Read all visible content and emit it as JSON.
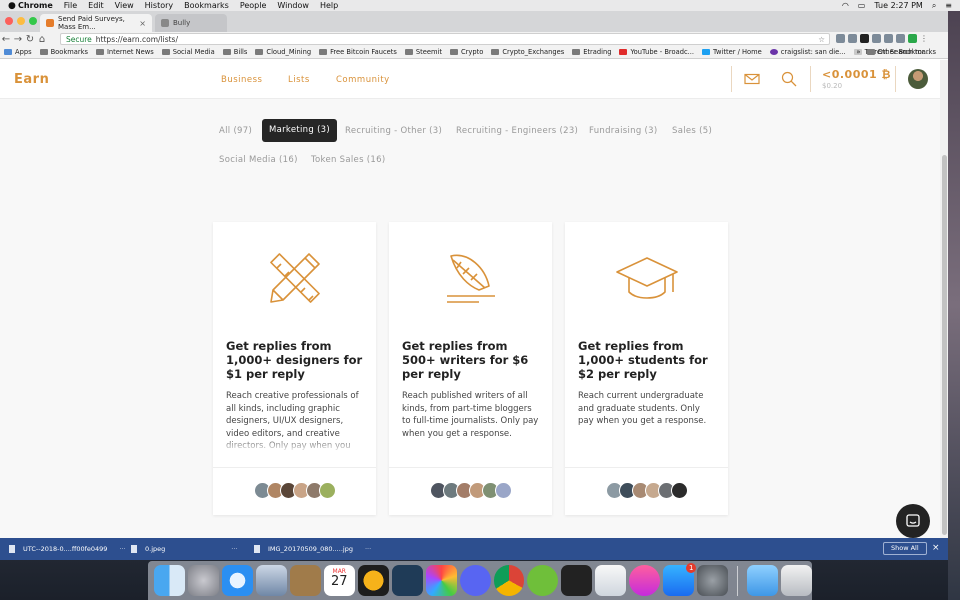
{
  "menubar": {
    "items": [
      "Chrome",
      "File",
      "Edit",
      "View",
      "History",
      "Bookmarks",
      "People",
      "Window",
      "Help"
    ],
    "clock": "Tue 2:27 PM"
  },
  "browser": {
    "tabs": [
      {
        "title": "Send Paid Surveys, Mass Em...",
        "active": true
      },
      {
        "title": "Bully",
        "active": false
      }
    ],
    "address": {
      "secure_label": "Secure",
      "url": "https://earn.com/lists/"
    },
    "bookmarks": [
      "Apps",
      "Bookmarks",
      "Internet News",
      "Social Media",
      "Bills",
      "Cloud_Mining",
      "Free Bitcoin Faucets",
      "Steemit",
      "Crypto",
      "Crypto_Exchanges",
      "Etrading",
      "YouTube - Broadc...",
      "Twitter / Home",
      "craigslist: san die...",
      "Torrent Search tor..."
    ],
    "other_bookmarks": "Other Bookmarks",
    "overflow": "»"
  },
  "site": {
    "logo": "Earn",
    "nav": [
      "Business",
      "Lists",
      "Community"
    ],
    "balance": "<0.0001 ₿",
    "balance_usd": "$0.20"
  },
  "filters": [
    {
      "label": "All (97)",
      "active": false
    },
    {
      "label": "Marketing (3)",
      "active": true
    },
    {
      "label": "Recruiting - Other (3)",
      "active": false
    },
    {
      "label": "Recruiting - Engineers (23)",
      "active": false
    },
    {
      "label": "Fundraising (3)",
      "active": false
    },
    {
      "label": "Sales (5)",
      "active": false
    },
    {
      "label": "Social Media (16)",
      "active": false
    },
    {
      "label": "Token Sales (16)",
      "active": false
    }
  ],
  "cards": [
    {
      "icon": "pencil-ruler-icon",
      "title": "Get replies from 1,000+ designers for $1 per reply",
      "body": "Reach creative professionals of all kinds, including graphic designers, UI/UX designers, video editors, and creative directors. Only pay when you get a response."
    },
    {
      "icon": "feather-quill-icon",
      "title": "Get replies from 500+ writers for $6 per reply",
      "body": "Reach published writers of all kinds, from part-time bloggers to full-time journalists. Only pay when you get a response."
    },
    {
      "icon": "graduation-cap-icon",
      "title": "Get replies from 1,000+ students for $2 per reply",
      "body": "Reach current undergraduate and graduate students. Only pay when you get a response."
    }
  ],
  "downloads": [
    {
      "name": "UTC--2018-0....ff00fe0499"
    },
    {
      "name": "0.jpeg"
    },
    {
      "name": "IMG_20170509_080.....jpg"
    }
  ],
  "downloads_bar": {
    "show_all": "Show All",
    "more": "···",
    "close": "×"
  },
  "dock": {
    "calendar_month": "MAR",
    "calendar_day": "27",
    "appstore_badge": "1"
  },
  "colors": {
    "accent": "#d9923a",
    "active_filter_bg": "#262626",
    "downloads_bar": "#2d4f8f"
  }
}
